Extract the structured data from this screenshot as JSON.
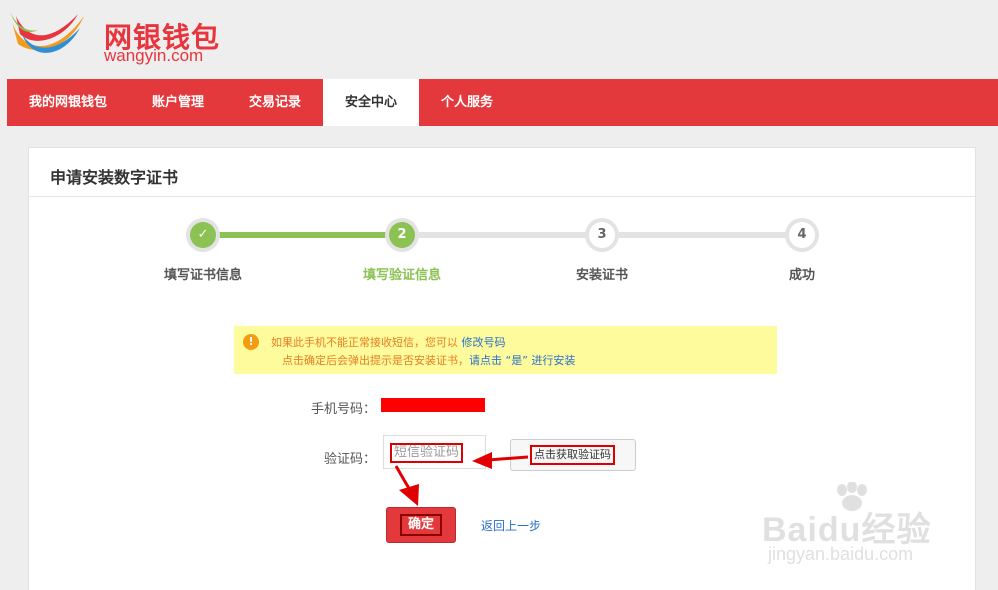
{
  "header": {
    "logo_cn": "网银钱包",
    "logo_en": "wangyin.com"
  },
  "nav": {
    "items": [
      {
        "label": "我的网银钱包",
        "active": false
      },
      {
        "label": "账户管理",
        "active": false
      },
      {
        "label": "交易记录",
        "active": false
      },
      {
        "label": "安全中心",
        "active": true
      },
      {
        "label": "个人服务",
        "active": false
      }
    ]
  },
  "panel": {
    "title": "申请安装数字证书"
  },
  "steps": [
    {
      "number": "✓",
      "label": "填写证书信息",
      "state": "done"
    },
    {
      "number": "2",
      "label": "填写验证信息",
      "state": "current"
    },
    {
      "number": "3",
      "label": "安装证书",
      "state": "todo"
    },
    {
      "number": "4",
      "label": "成功",
      "state": "todo"
    }
  ],
  "notice": {
    "icon": "!",
    "line1_text": "如果此手机不能正常接收短信，您可以",
    "line1_link": "修改号码",
    "line2_text": "点击确定后会弹出提示是否安装证书，",
    "line2_link": "请点击 “是” 进行安装"
  },
  "form": {
    "phone_label": "手机号码：",
    "code_label": "验证码：",
    "code_placeholder": "短信验证码",
    "get_code_button": "点击获取验证码",
    "confirm_button": "确定",
    "back_link": "返回上一步"
  },
  "watermark": {
    "big": "Baidu经验",
    "small": "jingyan.baidu.com"
  },
  "colors": {
    "brand_red": "#e3393c",
    "step_green": "#8cc153",
    "link_blue": "#2a6fc9",
    "notice_yellow": "#fefb9c"
  }
}
